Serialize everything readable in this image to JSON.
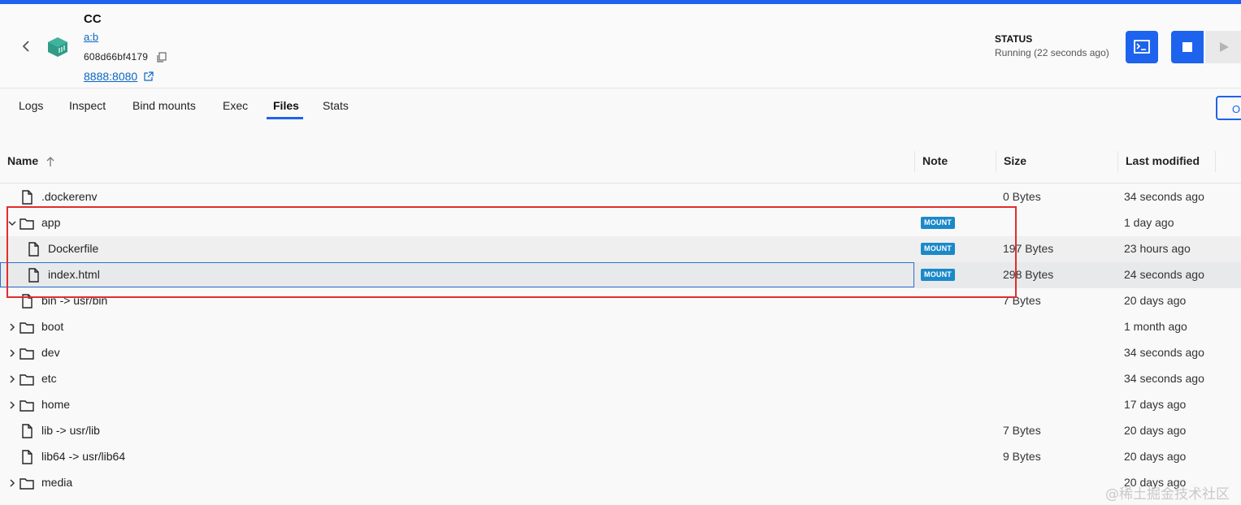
{
  "header": {
    "title": "CC",
    "image": "a:b",
    "container_id": "608d66bf4179",
    "port": "8888:8080",
    "status_label": "STATUS",
    "status_value": "Running (22 seconds ago)"
  },
  "tabs": [
    {
      "label": "Logs"
    },
    {
      "label": "Inspect"
    },
    {
      "label": "Bind mounts"
    },
    {
      "label": "Exec"
    },
    {
      "label": "Files",
      "active": true
    },
    {
      "label": "Stats"
    }
  ],
  "open_button": {
    "label": "Op"
  },
  "table": {
    "headers": {
      "name": "Name",
      "note": "Note",
      "size": "Size",
      "modified": "Last modified"
    },
    "rows": [
      {
        "name": ".dockerenv",
        "type": "file",
        "size": "0 Bytes",
        "modified": "34 seconds ago"
      },
      {
        "name": "app",
        "type": "folder",
        "expanded": true,
        "note": "MOUNT",
        "modified": "1 day ago"
      },
      {
        "name": "Dockerfile",
        "type": "file",
        "indent": 1,
        "note": "MOUNT",
        "size": "197 Bytes",
        "modified": "23 hours ago"
      },
      {
        "name": "index.html",
        "type": "file",
        "indent": 1,
        "note": "MOUNT",
        "size": "298 Bytes",
        "modified": "24 seconds ago",
        "selected": true
      },
      {
        "name": "bin -> usr/bin",
        "type": "file",
        "size": "7 Bytes",
        "modified": "20 days ago"
      },
      {
        "name": "boot",
        "type": "folder",
        "modified": "1 month ago"
      },
      {
        "name": "dev",
        "type": "folder",
        "modified": "34 seconds ago"
      },
      {
        "name": "etc",
        "type": "folder",
        "modified": "34 seconds ago"
      },
      {
        "name": "home",
        "type": "folder",
        "modified": "17 days ago"
      },
      {
        "name": "lib -> usr/lib",
        "type": "file",
        "size": "7 Bytes",
        "modified": "20 days ago"
      },
      {
        "name": "lib64 -> usr/lib64",
        "type": "file",
        "size": "9 Bytes",
        "modified": "20 days ago"
      },
      {
        "name": "media",
        "type": "folder",
        "modified": "20 days ago"
      }
    ]
  },
  "watermark": "@稀土掘金技术社区",
  "colors": {
    "accent": "#1d63ed",
    "badge": "#1b89c9",
    "annotation": "#e02d2d"
  }
}
